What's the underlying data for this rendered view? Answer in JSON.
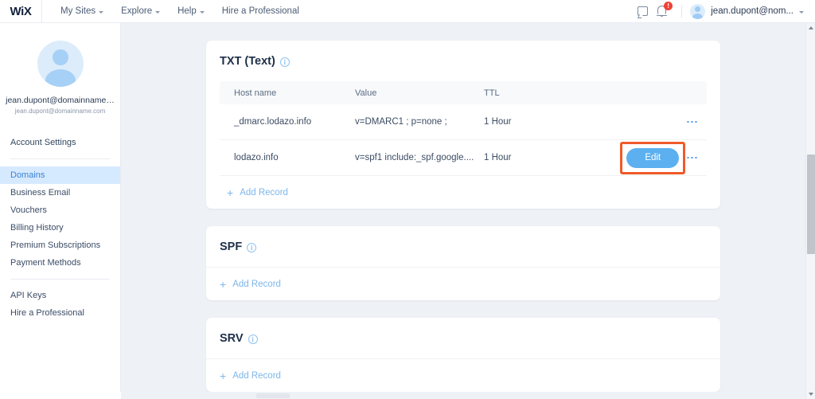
{
  "topbar": {
    "logo": "WiX",
    "nav": [
      {
        "label": "My Sites",
        "has_caret": true
      },
      {
        "label": "Explore",
        "has_caret": true
      },
      {
        "label": "Help",
        "has_caret": true
      },
      {
        "label": "Hire a Professional",
        "has_caret": false
      }
    ],
    "chat_icon": "chat-bubble-icon",
    "bell_icon": "notification-bell-icon",
    "notification_badge": "!",
    "user_email": "jean.dupont@nom...",
    "avatar_icon": "user-avatar-icon"
  },
  "sidebar": {
    "avatar_icon": "user-avatar-large-icon",
    "profile_name": "jean.dupont@domainname…",
    "profile_email": "jean.dupont@domainname.com",
    "account_settings": "Account Settings",
    "items": [
      {
        "label": "Domains",
        "active": true
      },
      {
        "label": "Business Email",
        "active": false
      },
      {
        "label": "Vouchers",
        "active": false
      },
      {
        "label": "Billing History",
        "active": false
      },
      {
        "label": "Premium Subscriptions",
        "active": false
      },
      {
        "label": "Payment Methods",
        "active": false
      }
    ],
    "items_secondary": [
      {
        "label": "API Keys"
      },
      {
        "label": "Hire a Professional"
      }
    ]
  },
  "colors": {
    "accent_blue": "#5cb0f0",
    "link_blue": "#7db6ea",
    "active_bg": "#d6eaff",
    "highlight_orange": "#f05a28",
    "badge_red": "#ef4236"
  },
  "txt_card": {
    "title": "TXT (Text)",
    "info_icon": "info-icon",
    "info_glyph": "i",
    "columns": [
      "Host name",
      "Value",
      "TTL"
    ],
    "rows": [
      {
        "host": "_dmarc.lodazo.info",
        "value": "v=DMARC1 ; p=none ;",
        "ttl": "1 Hour",
        "has_edit": false,
        "menu_icon": "more-options-icon"
      },
      {
        "host": "lodazo.info",
        "value": "v=spf1 include:_spf.google....",
        "ttl": "1 Hour",
        "has_edit": true,
        "edit_label": "Edit",
        "menu_icon": "more-options-icon",
        "highlighted": true
      }
    ],
    "add_record": "Add Record",
    "add_icon": "plus-icon"
  },
  "spf_card": {
    "title": "SPF",
    "info_icon": "info-icon",
    "info_glyph": "i",
    "add_record": "Add Record",
    "add_icon": "plus-icon"
  },
  "srv_card": {
    "title": "SRV",
    "info_icon": "info-icon",
    "info_glyph": "i",
    "add_record": "Add Record",
    "add_icon": "plus-icon"
  },
  "scrollbars": {
    "vertical_up_icon": "scroll-up-arrow-icon",
    "vertical_down_icon": "scroll-down-arrow-icon"
  }
}
